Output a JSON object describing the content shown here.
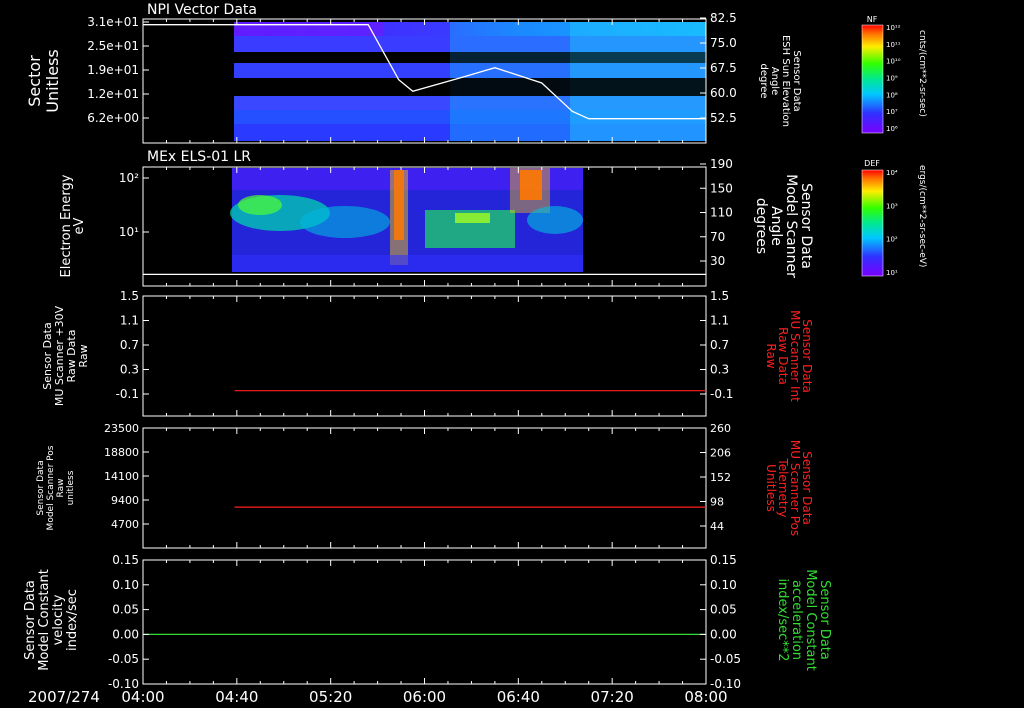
{
  "chart_data": {
    "type": "multi-panel time series",
    "date_label": "2007/274",
    "x": {
      "tick_labels": [
        "04:00",
        "04:40",
        "05:20",
        "06:00",
        "06:40",
        "07:20",
        "08:00"
      ],
      "range": [
        "04:00",
        "08:00"
      ]
    },
    "panels": [
      {
        "id": "npi",
        "type": "heatmap",
        "title": "NPI Vector Data",
        "ylabel": [
          "Sector",
          "Unitless"
        ],
        "yticks": [
          "3.1e+01",
          "2.5e+01",
          "1.9e+01",
          "1.2e+01",
          "6.2e+00"
        ],
        "ylim": [
          0,
          32
        ],
        "right_label": [
          "Sensor Data",
          "ESH Sun Elevation",
          "Angle",
          "degree"
        ],
        "right_ticks": [
          "82.5",
          "75.0",
          "67.5",
          "60.0",
          "52.5"
        ],
        "right_ylim": [
          45,
          82.5
        ],
        "line_series": {
          "name": "ESH Sun Elevation Angle",
          "color": "#ffffff",
          "x": [
            "04:00",
            "04:40",
            "05:36",
            "05:49",
            "05:55",
            "06:15",
            "06:30",
            "06:50",
            "07:03",
            "07:10",
            "08:00"
          ],
          "y": [
            80.5,
            80.5,
            80.5,
            64,
            60.5,
            64.5,
            67.6,
            63,
            54.5,
            52.3,
            52.3
          ]
        }
      },
      {
        "id": "els",
        "type": "heatmap",
        "title": "MEx ELS-01 LR",
        "ylabel": [
          "Electron Energy",
          "eV"
        ],
        "yticks": [
          "10²",
          "10¹"
        ],
        "ylim": [
          1.5,
          150
        ],
        "y_scale": "log",
        "right_label": [
          "Sensor Data",
          "Model Scanner",
          "Angle",
          "degrees"
        ],
        "right_ticks": [
          "190",
          "150",
          "110",
          "70",
          "30"
        ],
        "right_ylim": [
          0,
          190
        ],
        "line_series": {
          "name": "Model Scanner Angle",
          "color": "#ffffff",
          "x": [
            "04:00",
            "08:00"
          ],
          "y": [
            2.5,
            2.5
          ]
        }
      },
      {
        "id": "mu30",
        "type": "line",
        "ylabel": [
          "Sensor Data",
          "MU Scanner +30V",
          "Raw Data",
          "Raw"
        ],
        "yticks": [
          "1.5",
          "1.1",
          "0.7",
          "0.3",
          "-0.1"
        ],
        "ylim": [
          -0.4,
          1.5
        ],
        "right_label": [
          "Sensor Data",
          "MU Scanner Int",
          "Raw Data",
          "Raw"
        ],
        "right_ticks": [
          "1.5",
          "1.1",
          "0.7",
          "0.3",
          "-0.1"
        ],
        "right_label_color": "#ff2020",
        "series": [
          {
            "color": "#ff2020",
            "x": [
              "04:39",
              "08:00"
            ],
            "y": [
              0,
              0
            ]
          }
        ]
      },
      {
        "id": "mupos",
        "type": "line",
        "ylabel": [
          "Sensor Data",
          "Model Scanner Pos",
          "Raw",
          "unitless"
        ],
        "yticks": [
          "23500",
          "18800",
          "14100",
          "9400",
          "4700"
        ],
        "ylim": [
          0,
          23500
        ],
        "right_label": [
          "Sensor Data",
          "MU Scanner Pos",
          "Telemetry",
          "Unitless"
        ],
        "right_ticks": [
          "260",
          "206",
          "152",
          "98",
          "44"
        ],
        "right_label_color": "#ff2020",
        "series": [
          {
            "color": "#ff2020",
            "x": [
              "04:39",
              "08:00"
            ],
            "y": [
              8000,
              8000
            ]
          }
        ]
      },
      {
        "id": "const",
        "type": "line",
        "ylabel": [
          "Sensor Data",
          "Model Constant",
          "velocity",
          "index/sec"
        ],
        "yticks": [
          "0.15",
          "0.10",
          "0.05",
          "0.00",
          "-0.05",
          "-0.10"
        ],
        "ylim": [
          -0.1,
          0.15
        ],
        "right_label": [
          "Sensor Data",
          "Model Constant",
          "acceleration",
          "index/sec**2"
        ],
        "right_ticks": [
          "0.15",
          "0.10",
          "0.05",
          "0.00",
          "-0.05",
          "-0.10"
        ],
        "right_label_color": "#33dd33",
        "series": [
          {
            "color": "#33dd33",
            "x": [
              "04:00",
              "08:00"
            ],
            "y": [
              0,
              0
            ]
          }
        ]
      }
    ],
    "colorbars": [
      {
        "id": "nf",
        "label": "NF",
        "units": "cnts/(cm**2-sr-sec)",
        "tick_labels": [
          "10¹²",
          "10¹¹",
          "10¹⁰",
          "10⁹",
          "10⁸",
          "10⁷",
          "10⁶"
        ]
      },
      {
        "id": "def",
        "label": "DEF",
        "units": "ergs/(cm**2-sr-sec-eV)",
        "tick_labels": [
          "10⁴",
          "10³",
          "10²",
          "10¹"
        ]
      }
    ]
  }
}
